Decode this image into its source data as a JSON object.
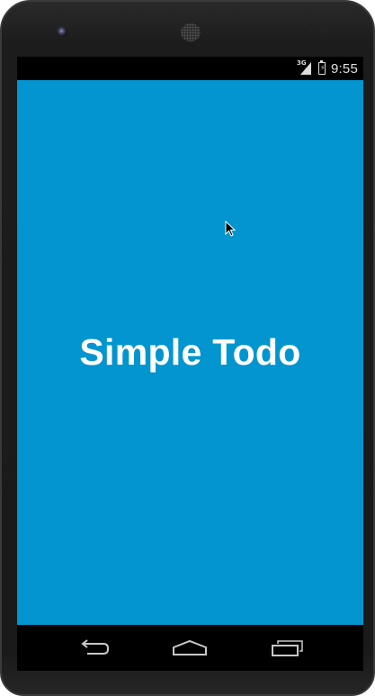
{
  "status_bar": {
    "network": "3G",
    "time": "9:55"
  },
  "app": {
    "title": "Simple Todo",
    "background_color": "#0295cf"
  },
  "nav_bar": {
    "buttons": [
      "back-icon",
      "home-icon",
      "recents-icon"
    ]
  }
}
